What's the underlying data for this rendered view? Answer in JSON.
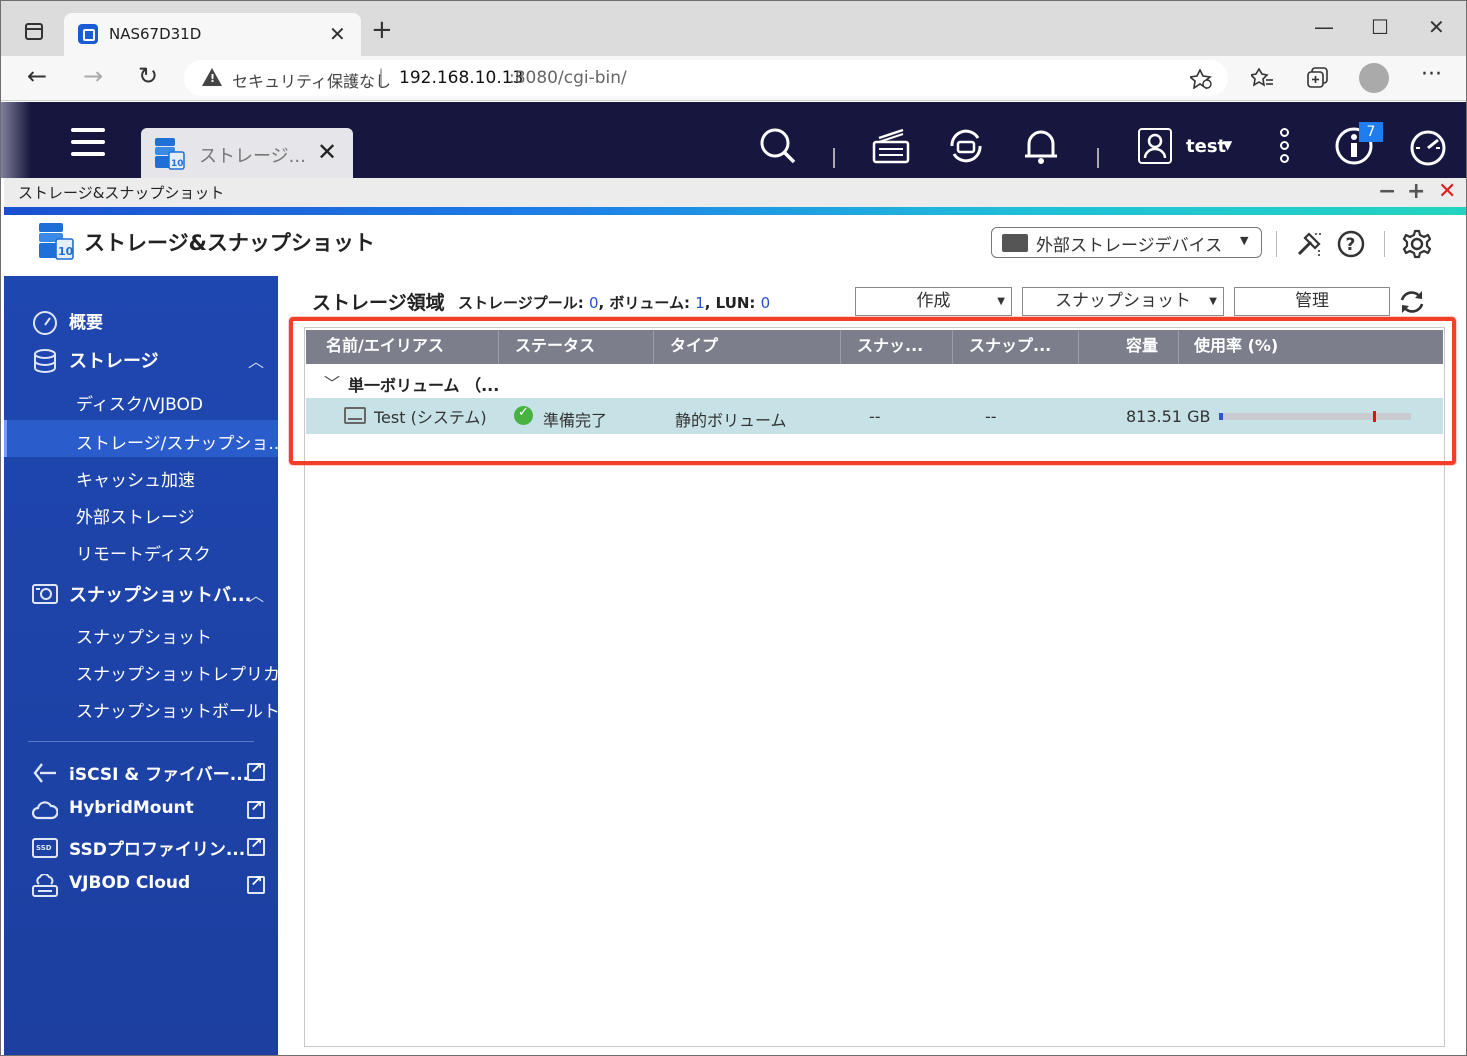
{
  "browser": {
    "tab_title": "NAS67D31D",
    "new_tab": "+",
    "security_label": "セキュリティ保護なし",
    "url_separator": "|",
    "url_host": "192.168.10.13",
    "url_path": ":8080/cgi-bin/",
    "window_controls": {
      "minimize": "—",
      "maximize": "☐",
      "close": "✕"
    },
    "nav": {
      "back": "←",
      "forward": "→",
      "reload": "↻"
    }
  },
  "qts": {
    "app_tab_label": "ストレージ...",
    "user_name": "test",
    "notification_count": "7"
  },
  "app": {
    "window_title": "ストレージ&スナップショット",
    "header_title": "ストレージ&スナップショット",
    "external_device_button": "外部ストレージデバイス",
    "window_buttons": {
      "minimize": "−",
      "maximize": "+",
      "close": "✕"
    }
  },
  "sidebar": {
    "overview": "概要",
    "storage": "ストレージ",
    "disks": "ディスク/VJBOD",
    "storage_snapshots": "ストレージ/スナップショ...",
    "cache": "キャッシュ加速",
    "external_storage": "外部ストレージ",
    "remote_disk": "リモートディスク",
    "snapshot_backup": "スナップショットバ...",
    "snapshot": "スナップショット",
    "snapshot_replica": "スナップショットレプリカ",
    "snapshot_vault": "スナップショットボールト",
    "iscsi": "iSCSI & ファイバー...",
    "hybridmount": "HybridMount",
    "ssd_profiling": "SSDプロファイリン...",
    "vjbod_cloud": "VJBOD Cloud"
  },
  "main": {
    "title": "ストレージ領域",
    "pool_label": "ストレージプール:",
    "pool_count": "0",
    "volume_label": "ボリューム:",
    "volume_count": "1",
    "lun_label": "LUN:",
    "lun_count": "0",
    "create_button": "作成",
    "snapshot_button": "スナップショット",
    "manage_button": "管理",
    "columns": [
      "名前/エイリアス",
      "ステータス",
      "タイプ",
      "スナッ...",
      "スナップ...",
      "容量",
      "使用率 (%)"
    ],
    "group_label": "単一ボリューム （...",
    "volume": {
      "name": "Test (システム)",
      "status": "準備完了",
      "type": "静的ボリューム",
      "snap1": "--",
      "snap2": "--",
      "capacity": "813.51 GB",
      "usage_fraction": 0.02,
      "threshold_fraction": 0.8
    }
  },
  "colors": {
    "accent": "#2453c8",
    "sidebar": "#1f47b0",
    "topbar": "#16163f",
    "highlight": "#f33e2a",
    "status_ok": "#49b341"
  }
}
